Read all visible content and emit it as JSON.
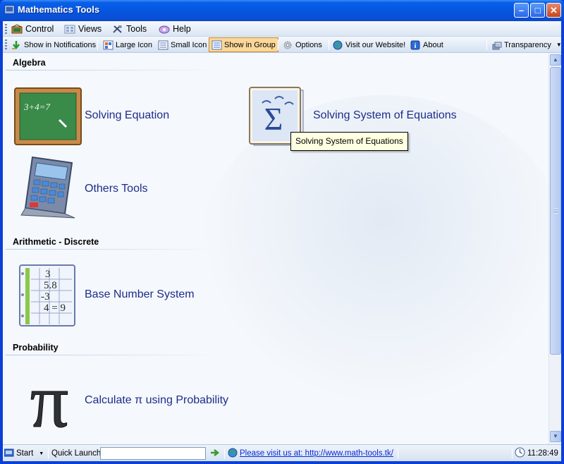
{
  "window": {
    "title": "Mathematics Tools"
  },
  "menu": [
    {
      "label": "Control",
      "icon": "control-icon"
    },
    {
      "label": "Views",
      "icon": "views-icon"
    },
    {
      "label": "Tools",
      "icon": "tools-icon"
    },
    {
      "label": "Help",
      "icon": "help-icon"
    }
  ],
  "toolbar": {
    "show_in_notifications": "Show in Notifications",
    "large_icon": "Large Icon",
    "small_icon": "Small Icon",
    "show_in_group": "Show in Group",
    "options": "Options",
    "visit_website": "Visit our Website!",
    "about": "About",
    "transparency": "Transparency"
  },
  "groups": [
    {
      "title": "Algebra",
      "tools": [
        "Solving Equation",
        "Solving System of Equations",
        "Others Tools"
      ]
    },
    {
      "title": "Arithmetic - Discrete",
      "tools": [
        "Base Number System"
      ]
    },
    {
      "title": "Probability",
      "tools": [
        "Calculate π using Probability"
      ]
    }
  ],
  "icons": {
    "chalkboard_text": "3+4=7",
    "sigma": "Σ",
    "pi": "π",
    "table_cells": [
      "3",
      "5.8",
      "-3",
      "4 = 9"
    ]
  },
  "tooltip": "Solving System of Equations",
  "statusbar": {
    "start": "Start",
    "quick_launch": "Quick Launch",
    "quick_launch_value": "",
    "visit_link": "Please visit us at: http://www.math-tools.tk/",
    "clock": "11:28:49"
  },
  "colors": {
    "titlebar": "#0556e0",
    "label_text": "#1d2d8a",
    "active_toolbar": "#fbd79a",
    "tooltip_bg": "#ffffe1"
  }
}
